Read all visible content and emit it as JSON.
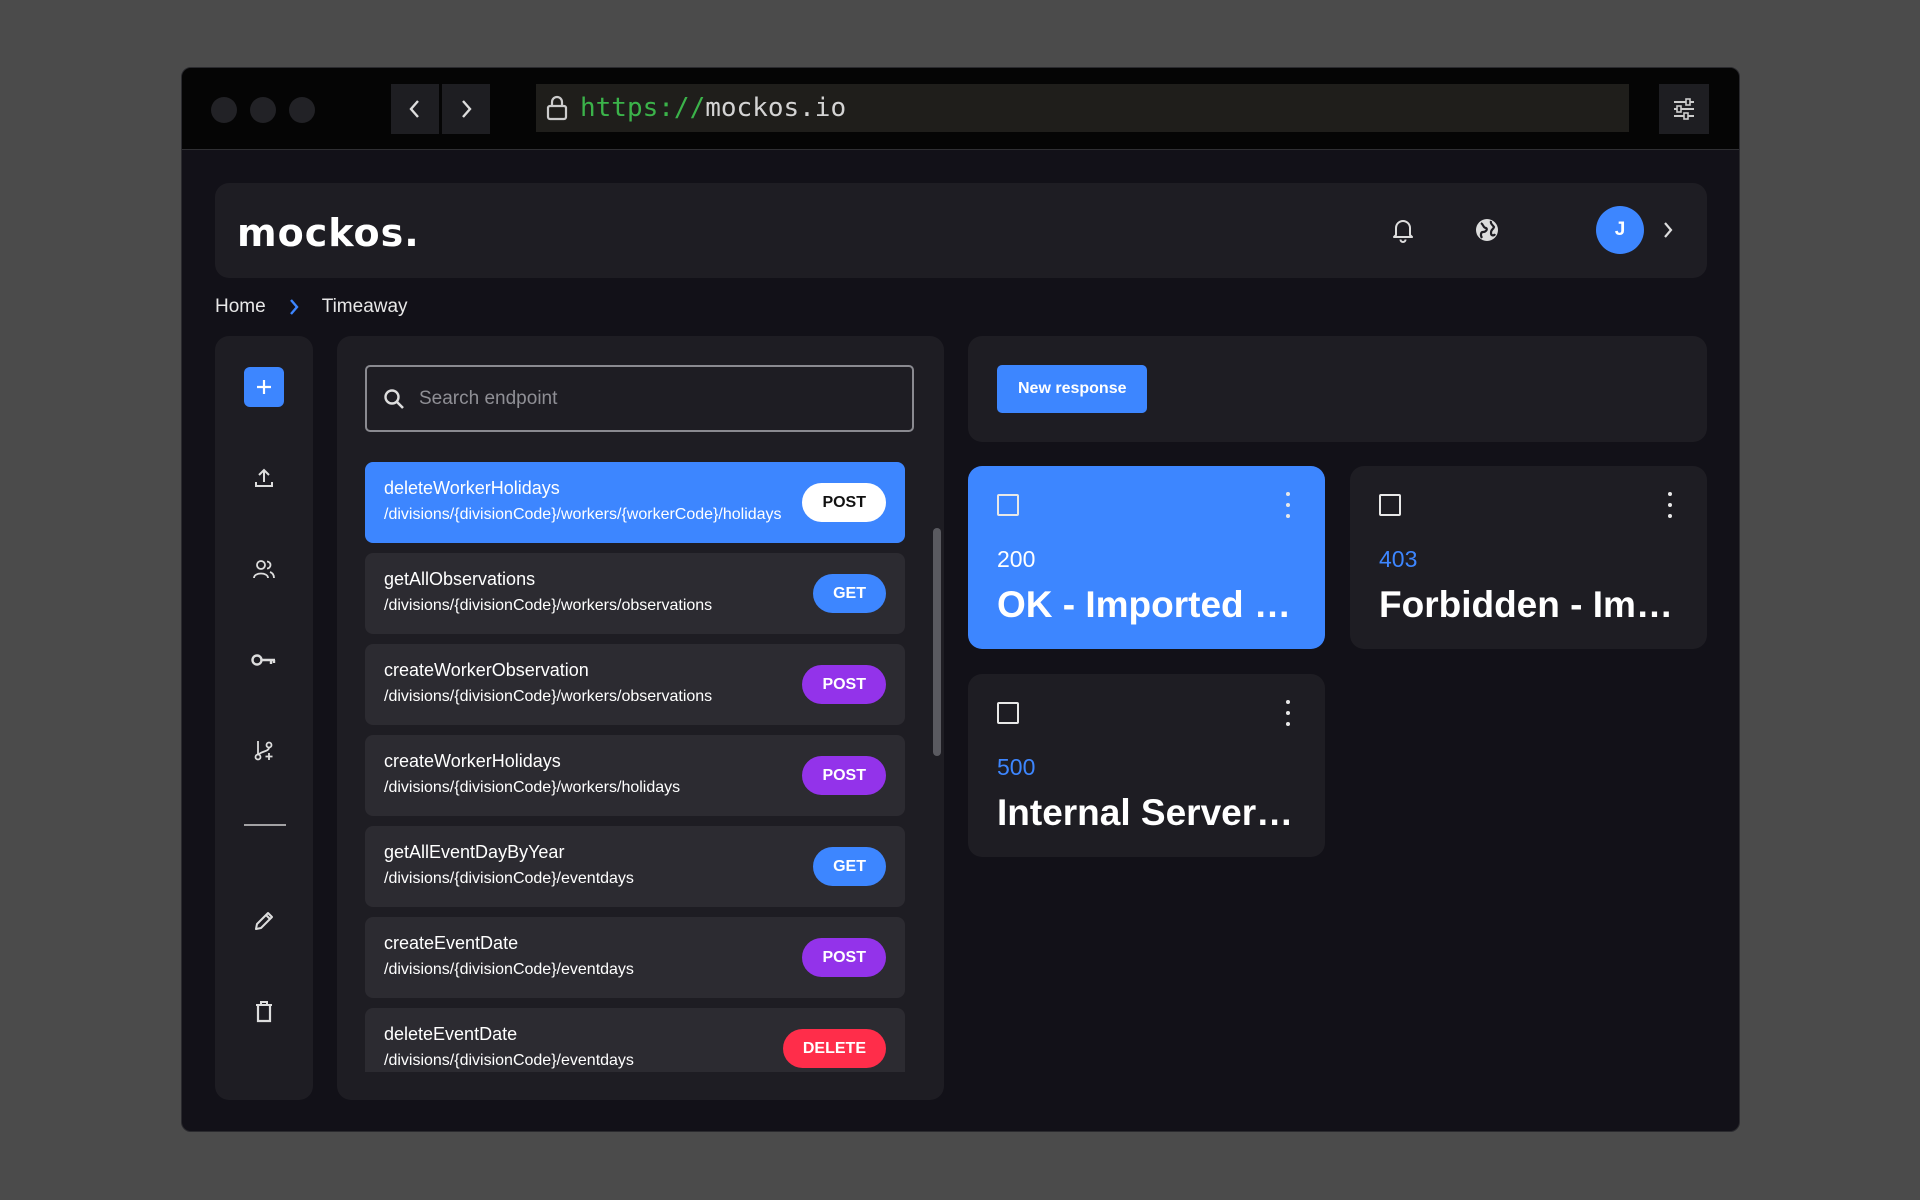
{
  "browser": {
    "url_protocol": "https://",
    "url_host": "mockos.io"
  },
  "header": {
    "logo": "mockos.",
    "avatar_initial": "J"
  },
  "breadcrumb": {
    "home": "Home",
    "current": "Timeaway"
  },
  "search": {
    "placeholder": "Search endpoint"
  },
  "endpoints": [
    {
      "name": "deleteWorkerHolidays",
      "path": "/divisions/{divisionCode}/workers/{workerCode}/holidays",
      "method": "POST"
    },
    {
      "name": "getAllObservations",
      "path": "/divisions/{divisionCode}/workers/observations",
      "method": "GET"
    },
    {
      "name": "createWorkerObservation",
      "path": "/divisions/{divisionCode}/workers/observations",
      "method": "POST"
    },
    {
      "name": "createWorkerHolidays",
      "path": "/divisions/{divisionCode}/workers/holidays",
      "method": "POST"
    },
    {
      "name": "getAllEventDayByYear",
      "path": "/divisions/{divisionCode}/eventdays",
      "method": "GET"
    },
    {
      "name": "createEventDate",
      "path": "/divisions/{divisionCode}/eventdays",
      "method": "POST"
    },
    {
      "name": "deleteEventDate",
      "path": "/divisions/{divisionCode}/eventdays",
      "method": "DELETE"
    }
  ],
  "responses_toolbar": {
    "new_response_label": "New response"
  },
  "responses": [
    {
      "code": "200",
      "title": "OK - Imported response"
    },
    {
      "code": "403",
      "title": "Forbidden - Imported response"
    },
    {
      "code": "500",
      "title": "Internal Server Error"
    }
  ],
  "colors": {
    "accent": "#3d86ff",
    "post": "#9333ea",
    "delete": "#ff2d4a"
  }
}
